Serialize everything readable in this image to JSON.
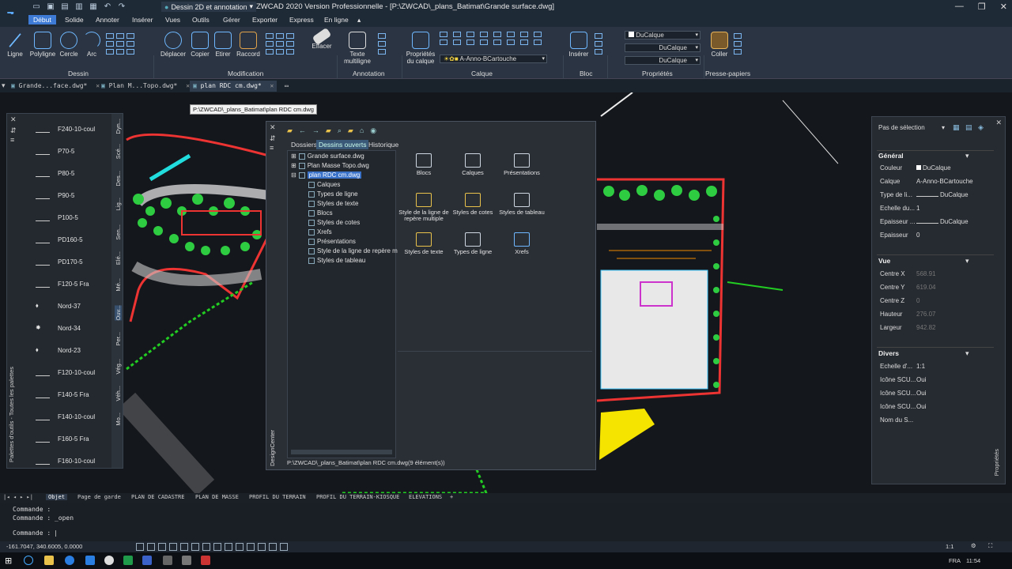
{
  "titlebar": {
    "workspace": "Dessin 2D et annotation",
    "title": "ZWCAD 2020 Version Professionnelle - [P:\\ZWCAD\\_plans_Batimat\\Grande surface.dwg]"
  },
  "menu_tabs": [
    "Début",
    "Solide",
    "Annoter",
    "Insérer",
    "Vues",
    "Outils",
    "Gérer",
    "Exporter",
    "Express",
    "En ligne"
  ],
  "ribbon": {
    "draw": [
      "Ligne",
      "Polyligne",
      "Cercle",
      "Arc"
    ],
    "modify": [
      "Déplacer",
      "Copier",
      "Etirer",
      "Raccord",
      "Effacer"
    ],
    "annotation": [
      "Texte multiligne"
    ],
    "layer_props": "Propriétés du calque",
    "layer_value": "A-Anno-BCartouche",
    "block": "Insérer",
    "prop_values": [
      "DuCalque",
      "DuCalque",
      "DuCalque"
    ],
    "clipboard": "Coller",
    "groups": [
      "Dessin",
      "Modification",
      "Annotation",
      "Calque",
      "Bloc",
      "Propriétés",
      "Presse-papiers"
    ]
  },
  "doc_tabs": [
    {
      "label": "Grande...face.dwg*"
    },
    {
      "label": "Plan M...Topo.dwg*"
    },
    {
      "label": "plan RDC cm.dwg*"
    }
  ],
  "tooltip": "P:\\ZWCAD\\_plans_Batimat\\plan RDC cm.dwg",
  "palette": {
    "items": [
      "F240-10-coul",
      "P70-5",
      "P80-5",
      "P90-5",
      "P100-5",
      "PD160-5",
      "PD170-5",
      "F120-5 Fra",
      "Nord-37",
      "Nord-34",
      "Nord-23",
      "F120-10-coul",
      "F140-5 Fra",
      "F140-10-coul",
      "F160-5 Fra",
      "F160-10-coul"
    ],
    "tabs": [
      "Dyn...",
      "Scé...",
      "Des...",
      "Lig...",
      "Sen...",
      "Elé...",
      "Mé...",
      "Ouv...",
      "Per...",
      "Vég...",
      "Véh...",
      "Mo..."
    ],
    "vertical_label": "Palettes d'outils - Toutes les palettes"
  },
  "design_center": {
    "tabs": [
      "Dossiers",
      "Dessins ouverts",
      "Historique"
    ],
    "tree": [
      "Grande surface.dwg",
      "Plan Masse Topo.dwg",
      "plan RDC cm.dwg",
      "Calques",
      "Types de ligne",
      "Styles de texte",
      "Blocs",
      "Styles de cotes",
      "Xrefs",
      "Présentations",
      "Style de la ligne de repère m",
      "Styles de tableau"
    ],
    "items": [
      "Blocs",
      "Calques",
      "Présentations",
      "Style de la ligne de repère multiple",
      "Styles de cotes",
      "Styles de tableau",
      "Styles de texte",
      "Types de ligne",
      "Xrefs"
    ],
    "status": "P:\\ZWCAD\\_plans_Batimat\\plan RDC cm.dwg(9 élément(s))",
    "vertical_label": "DesignCenter"
  },
  "properties": {
    "selection": "Pas de sélection",
    "sections": [
      "Général",
      "Vue",
      "Divers"
    ],
    "general": [
      [
        "Couleur",
        "DuCalque"
      ],
      [
        "Calque",
        "A-Anno-BCartouche"
      ],
      [
        "Type de li...",
        "DuCalque"
      ],
      [
        "Echelle du...",
        "1"
      ],
      [
        "Epaisseur ...",
        "DuCalque"
      ],
      [
        "Epaisseur",
        "0"
      ]
    ],
    "view": [
      [
        "Centre X",
        "568.91"
      ],
      [
        "Centre Y",
        "619.04"
      ],
      [
        "Centre Z",
        "0"
      ],
      [
        "Hauteur",
        "276.07"
      ],
      [
        "Largeur",
        "942.82"
      ]
    ],
    "misc": [
      [
        "Echelle d'...",
        "1:1"
      ],
      [
        "Icône SCU...",
        "Oui"
      ],
      [
        "Icône SCU...",
        "Oui"
      ],
      [
        "Icône SCU...",
        "Oui"
      ],
      [
        "Nom du S...",
        ""
      ]
    ],
    "vertical_label": "Propriétés"
  },
  "layout_tabs": [
    "Objet",
    "Page de garde",
    "PLAN DE CADASTRE",
    "PLAN DE MASSE",
    "PROFIL DU TERRAIN",
    "PROFIL DU TERRAIN-KIOSQUE",
    "ELEVATIONS"
  ],
  "command": {
    "lines": [
      "Commande :",
      "Commande : _open"
    ],
    "prompt": "Commande :"
  },
  "status": {
    "coords": "-161.7047, 340.6005, 0.0000",
    "scale": "1:1"
  },
  "taskbar": {
    "lang": "FRA",
    "time": "11:54"
  }
}
